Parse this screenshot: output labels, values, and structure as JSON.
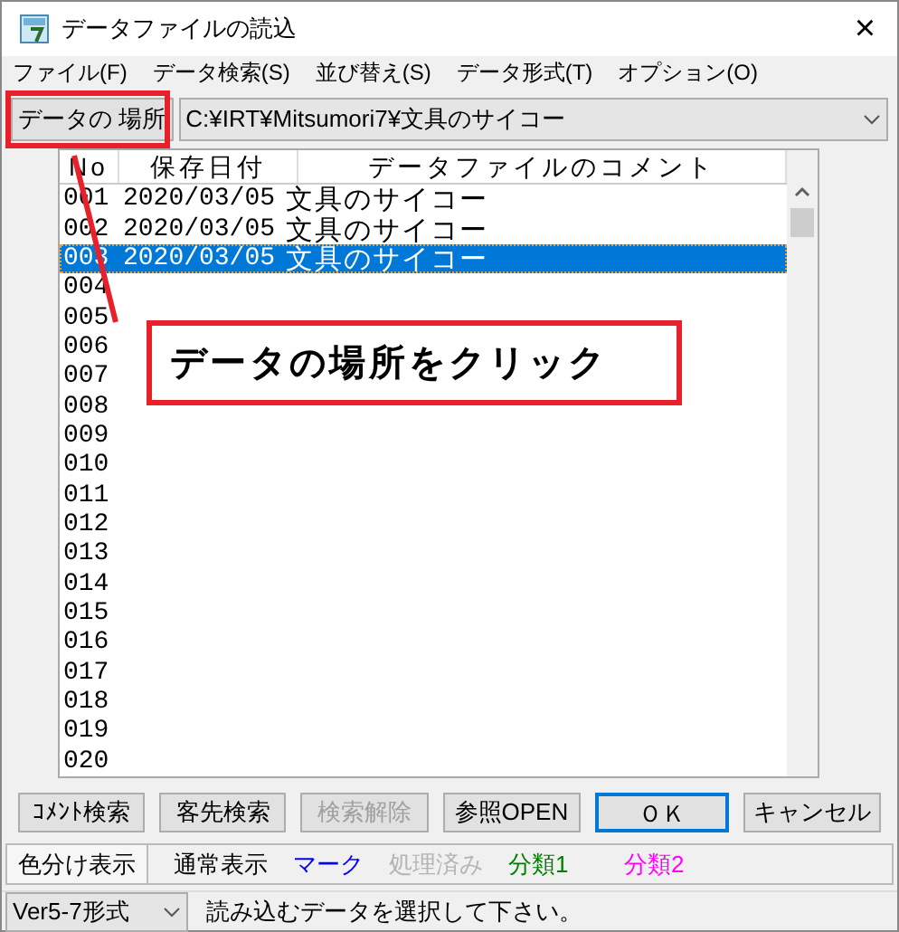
{
  "window": {
    "title": "データファイルの読込",
    "close": "×"
  },
  "menu": [
    {
      "label": "ファイル(F)"
    },
    {
      "label": "データ検索(S)"
    },
    {
      "label": "並び替え(S)"
    },
    {
      "label": "データ形式(T)"
    },
    {
      "label": "オプション(O)"
    }
  ],
  "location": {
    "button": "データの 場所",
    "path": "C:¥IRT¥Mitsumori7¥文具のサイコー"
  },
  "list": {
    "columns": [
      "No",
      "保存日付",
      "データファイルのコメント"
    ],
    "rows": [
      {
        "no": "001",
        "date": "2020/03/05",
        "comment": "文具のサイコー",
        "selected": false
      },
      {
        "no": "002",
        "date": "2020/03/05",
        "comment": "文具のサイコー",
        "selected": false
      },
      {
        "no": "003",
        "date": "2020/03/05",
        "comment": "文具のサイコー",
        "selected": true
      },
      {
        "no": "004",
        "selected": false
      },
      {
        "no": "005",
        "selected": false
      },
      {
        "no": "006",
        "selected": false
      },
      {
        "no": "007",
        "selected": false
      },
      {
        "no": "008",
        "selected": false
      },
      {
        "no": "009",
        "selected": false
      },
      {
        "no": "010",
        "selected": false
      },
      {
        "no": "011",
        "selected": false
      },
      {
        "no": "012",
        "selected": false
      },
      {
        "no": "013",
        "selected": false
      },
      {
        "no": "014",
        "selected": false
      },
      {
        "no": "015",
        "selected": false
      },
      {
        "no": "016",
        "selected": false
      },
      {
        "no": "017",
        "selected": false
      },
      {
        "no": "018",
        "selected": false
      },
      {
        "no": "019",
        "selected": false
      },
      {
        "no": "020",
        "selected": false
      }
    ]
  },
  "buttons": [
    {
      "label": "ｺﾒﾝﾄ検索",
      "disabled": false,
      "focused": false
    },
    {
      "label": "客先検索",
      "disabled": false,
      "focused": false
    },
    {
      "label": "検索解除",
      "disabled": true,
      "focused": false
    },
    {
      "label": "参照OPEN",
      "disabled": false,
      "focused": false
    },
    {
      "label": "ＯＫ",
      "disabled": false,
      "focused": true
    },
    {
      "label": "キャンセル",
      "disabled": false,
      "focused": false
    }
  ],
  "legend": {
    "button": "色分け表示",
    "items": [
      {
        "label": "通常表示",
        "color": "#000000"
      },
      {
        "label": "マーク",
        "color": "#0000ff"
      },
      {
        "label": "処理済み",
        "color": "#b4b4b4"
      },
      {
        "label": "分類1",
        "color": "#008000"
      },
      {
        "label": "分類2",
        "color": "#ff00ff"
      }
    ]
  },
  "status": {
    "format": "Ver5-7形式",
    "message": "読み込むデータを選択して下さい。"
  },
  "annotation": {
    "text": "データの場所をクリック"
  }
}
